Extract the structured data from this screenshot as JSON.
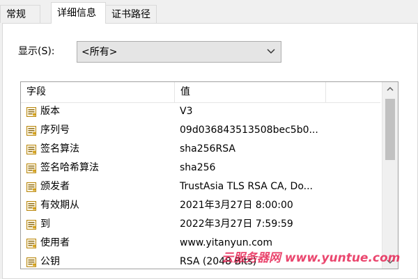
{
  "tabs": [
    {
      "label": "常规",
      "active": false
    },
    {
      "label": "详细信息",
      "active": true
    },
    {
      "label": "证书路径",
      "active": false
    }
  ],
  "show": {
    "label": "显示(S):",
    "selected": "<所有>"
  },
  "list": {
    "columns": [
      "字段",
      "值"
    ],
    "rows": [
      {
        "field": "版本",
        "value": "V3",
        "icon": "certificate-field-icon"
      },
      {
        "field": "序列号",
        "value": "09d036843513508bec5b0...",
        "icon": "certificate-field-icon"
      },
      {
        "field": "签名算法",
        "value": "sha256RSA",
        "icon": "certificate-field-icon"
      },
      {
        "field": "签名哈希算法",
        "value": "sha256",
        "icon": "certificate-field-icon"
      },
      {
        "field": "颁发者",
        "value": "TrustAsia TLS RSA CA, Do...",
        "icon": "certificate-field-icon"
      },
      {
        "field": "有效期从",
        "value": "2021年3月27日 8:00:00",
        "icon": "certificate-field-icon"
      },
      {
        "field": "到",
        "value": "2022年3月27日 7:59:59",
        "icon": "certificate-field-icon"
      },
      {
        "field": "使用者",
        "value": "www.yitanyun.com",
        "icon": "certificate-field-icon"
      },
      {
        "field": "公钥",
        "value": "RSA (2048 Bits)",
        "icon": "certificate-field-icon"
      }
    ]
  },
  "watermark": "云服务器网 www.yuntue.com",
  "colors": {
    "watermark": "#e6194b",
    "scroll_thumb": "#c1c1c1"
  }
}
